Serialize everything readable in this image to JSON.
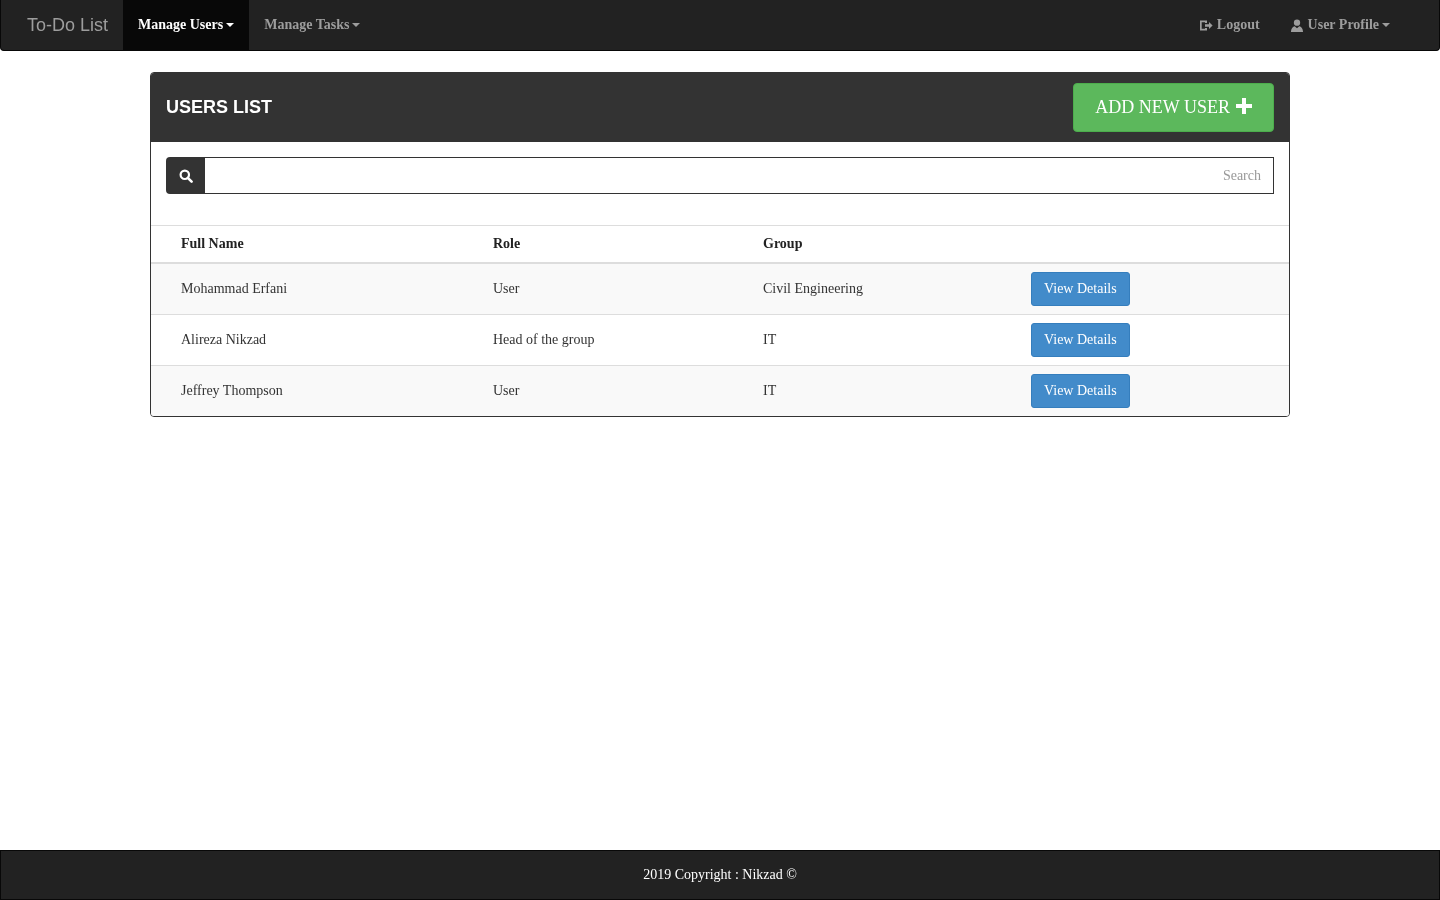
{
  "navbar": {
    "brand": "To-Do List",
    "menus": [
      {
        "label": "Manage Users",
        "selected": true,
        "dropdown": true
      },
      {
        "label": "Manage Tasks",
        "selected": false,
        "dropdown": true
      }
    ],
    "right": [
      {
        "kind": "logout",
        "label": "Logout",
        "dropdown": false
      },
      {
        "kind": "profile",
        "label": "User Profile",
        "dropdown": true
      }
    ]
  },
  "panel": {
    "title": "USERS LIST",
    "add_button": "ADD NEW USER",
    "search": {
      "placeholder": "Search"
    },
    "table": {
      "columns": [
        "Full Name",
        "Role",
        "Group"
      ],
      "rows": [
        {
          "full_name": "Mohammad Erfani",
          "role": "User",
          "group": "Civil Engineering",
          "action": "View Details"
        },
        {
          "full_name": "Alireza Nikzad",
          "role": "Head of the group",
          "group": "IT",
          "action": "View Details"
        },
        {
          "full_name": "Jeffrey Thompson",
          "role": "User",
          "group": "IT",
          "action": "View Details"
        }
      ]
    }
  },
  "footer": {
    "text": "2019 Copyright : Nikzad ©"
  }
}
